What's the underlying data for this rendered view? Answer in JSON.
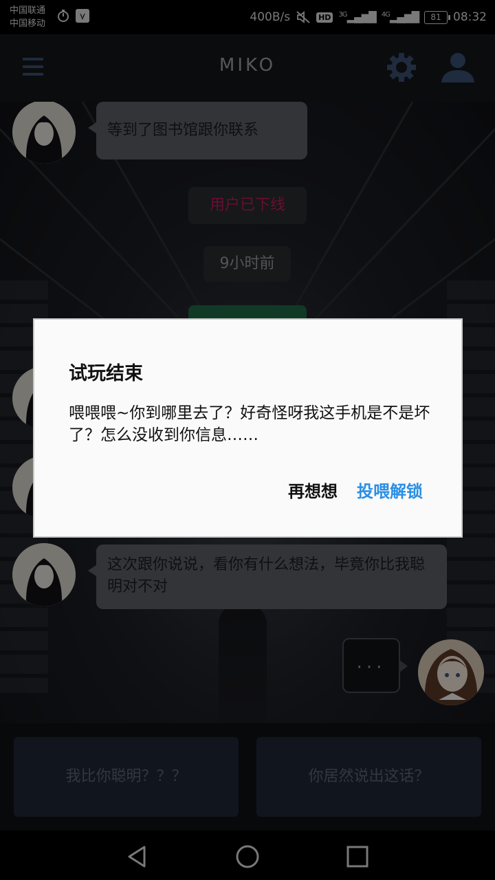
{
  "status_bar": {
    "carrier_1": "中国联通",
    "carrier_2": "中国移动",
    "net_speed": "400B/s",
    "hd_label": "HD",
    "net_type_1": "3G",
    "net_type_2": "4G",
    "battery": "81",
    "time": "08:32",
    "icons": [
      "stopwatch-icon",
      "huawei-icon",
      "mute-icon",
      "signal-icon"
    ]
  },
  "app_bar": {
    "title": "MIKO",
    "icons": [
      "menu-icon",
      "gear-icon",
      "person-icon"
    ],
    "accent": "#3a4f72"
  },
  "chat": {
    "messages": [
      {
        "type": "incoming",
        "text": "等到了图书馆跟你联系"
      },
      {
        "type": "system",
        "text": "用户已下线",
        "color": "#c2185b"
      },
      {
        "type": "time",
        "text": "9小时前"
      },
      {
        "type": "incoming",
        "text": "这次跟你说说，看你有什么想法，毕竟你比我聪明对不对"
      }
    ],
    "typing_indicator": "···"
  },
  "choices": [
    {
      "label": "我比你聪明？？？"
    },
    {
      "label": "你居然说出这话？"
    }
  ],
  "dialog": {
    "title": "试玩结束",
    "message": "喂喂喂~你到哪里去了？好奇怪呀我这手机是不是坏了？怎么没收到你信息……",
    "cancel_label": "再想想",
    "confirm_label": "投喂解锁",
    "confirm_color": "#2a8fe6"
  },
  "nav_bar": {
    "icons": [
      "back-icon",
      "home-icon",
      "recents-icon"
    ]
  }
}
